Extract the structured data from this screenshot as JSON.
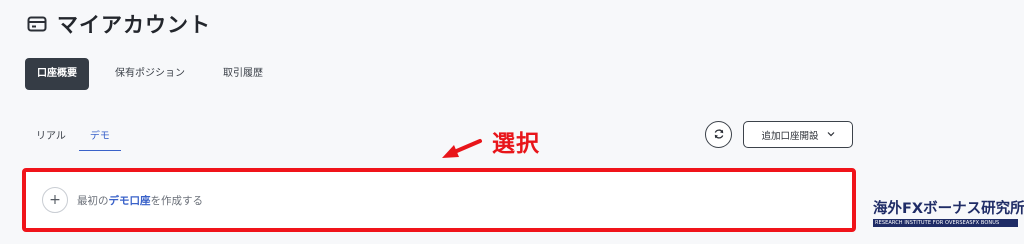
{
  "header": {
    "title": "マイアカウント",
    "icon": "credit-card-icon"
  },
  "top_tabs": [
    {
      "label": "口座概要",
      "active": true
    },
    {
      "label": "保有ポジション",
      "active": false
    },
    {
      "label": "取引履歴",
      "active": false
    }
  ],
  "sub_tabs": [
    {
      "label": "リアル",
      "active": false
    },
    {
      "label": "デモ",
      "active": true
    }
  ],
  "annotation": {
    "label": "選択",
    "color": "#e8151a"
  },
  "actions": {
    "refresh_icon": "refresh-icon",
    "add_account_label": "追加口座開設",
    "add_account_icon": "chevron-down-icon"
  },
  "create_demo": {
    "prefix": "最初の",
    "emphasis": "デモ口座",
    "suffix": "を作成する",
    "icon": "plus-icon"
  },
  "watermark": {
    "main": "海外FXボーナス研究所",
    "sub": "RESEARCH INSTITUTE FOR OVERSEASFX BONUS"
  },
  "colors": {
    "accent": "#3a62c9",
    "active_tab_bg": "#353c45",
    "highlight": "#f0141a",
    "brand": "#1f2c66"
  }
}
